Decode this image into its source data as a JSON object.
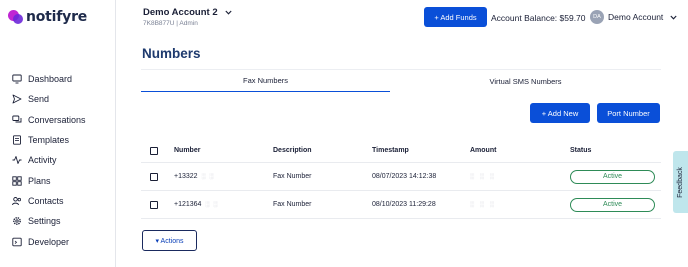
{
  "brand": {
    "name": "notifyre"
  },
  "sidebar": {
    "items": [
      {
        "label": "Dashboard",
        "icon": "monitor-icon"
      },
      {
        "label": "Send",
        "icon": "send-icon"
      },
      {
        "label": "Conversations",
        "icon": "chat-icon"
      },
      {
        "label": "Templates",
        "icon": "template-icon"
      },
      {
        "label": "Activity",
        "icon": "activity-icon"
      },
      {
        "label": "Plans",
        "icon": "plans-icon"
      },
      {
        "label": "Contacts",
        "icon": "contacts-icon"
      },
      {
        "label": "Settings",
        "icon": "gear-icon"
      },
      {
        "label": "Developer",
        "icon": "code-icon"
      }
    ]
  },
  "header": {
    "account_name": "Demo Account 2",
    "account_id": "7K8B877U",
    "account_role": "Admin",
    "add_funds_label": "+ Add Funds",
    "balance_text": "Account Balance: $59.70",
    "avatar_initials": "DA",
    "user_name": "Demo Account"
  },
  "page": {
    "title": "Numbers",
    "tabs": [
      {
        "label": "Fax Numbers",
        "active": true
      },
      {
        "label": "Virtual SMS Numbers",
        "active": false
      }
    ],
    "add_new_label": "+ Add New",
    "port_number_label": "Port Number",
    "actions_label": "▾ Actions"
  },
  "table": {
    "headers": [
      "Number",
      "Description",
      "Timestamp",
      "Amount",
      "Status"
    ],
    "rows": [
      {
        "number": "+13322",
        "description": "Fax Number",
        "timestamp": "08/07/2023 14:12:38",
        "status": "Active"
      },
      {
        "number": "+121364",
        "description": "Fax Number",
        "timestamp": "08/10/2023 11:29:28",
        "status": "Active"
      }
    ]
  },
  "feedback": {
    "label": "Feedback"
  },
  "colors": {
    "primary": "#0a4fd8",
    "title": "#1e3a6e",
    "active_green": "#2e8b57",
    "feedback_bg": "#bfe6ec"
  }
}
